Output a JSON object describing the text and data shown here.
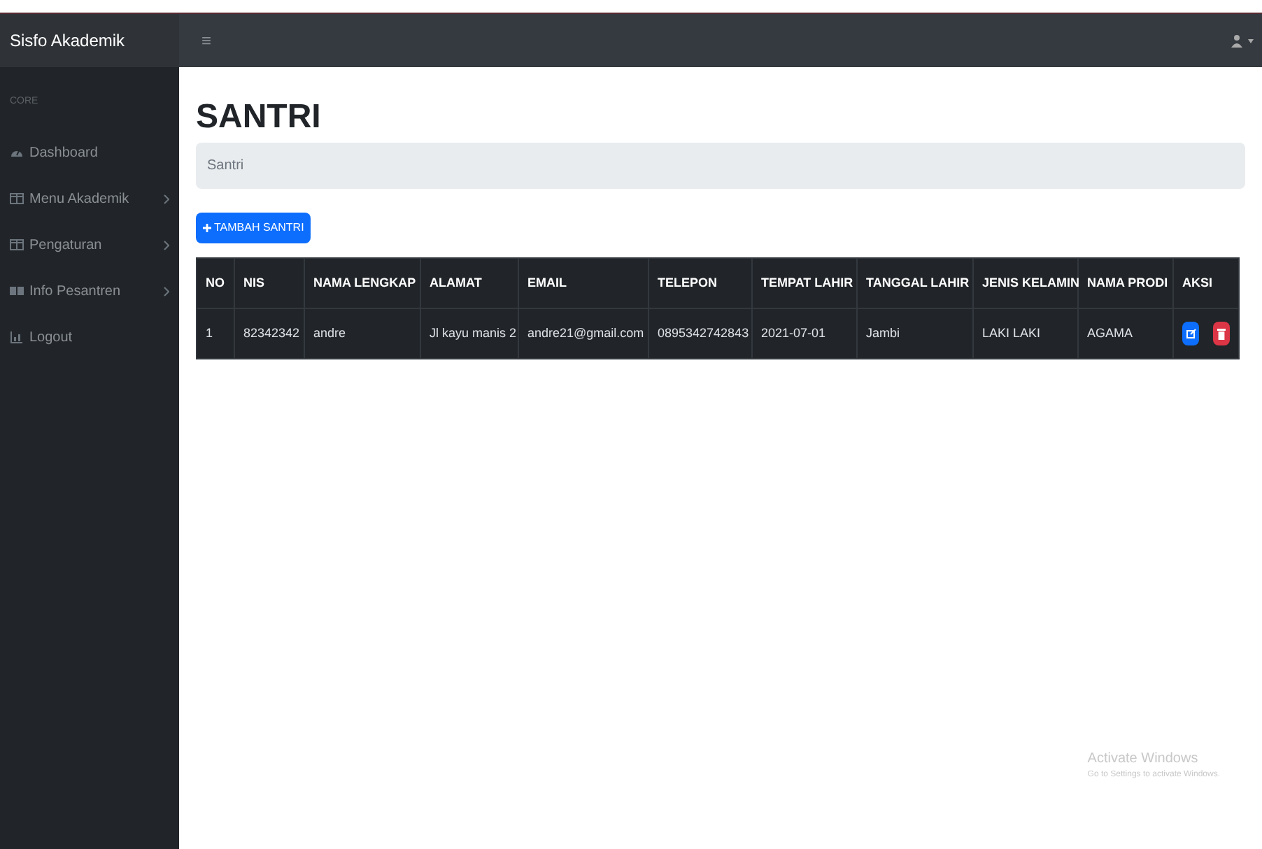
{
  "navbar": {
    "brand": "Sisfo Akademik",
    "menu_toggle": "≡"
  },
  "sidebar": {
    "heading": "CORE",
    "items": [
      {
        "label": "Dashboard",
        "kind": "gauge",
        "expandable": false
      },
      {
        "label": "Menu Akademik",
        "kind": "columns",
        "expandable": true
      },
      {
        "label": "Pengaturan",
        "kind": "columns",
        "expandable": true
      },
      {
        "label": "Info Pesantren",
        "kind": "book",
        "expandable": true
      },
      {
        "label": "Logout",
        "kind": "chart",
        "expandable": false
      }
    ]
  },
  "page": {
    "title": "SANTRI",
    "breadcrumb": "Santri",
    "add_button": "TAMBAH SANTRI"
  },
  "table": {
    "columns": [
      "NO",
      "NIS",
      "NAMA LENGKAP",
      "ALAMAT",
      "EMAIL",
      "TELEPON",
      "TEMPAT LAHIR",
      "TANGGAL LAHIR",
      "JENIS KELAMIN",
      "NAMA PRODI",
      "AKSI"
    ],
    "rows": [
      {
        "cells": [
          "1",
          "82342342",
          "andre",
          "Jl kayu manis 2",
          "andre21@gmail.com",
          "0895342742843",
          "2021-07-01",
          "Jambi",
          "LAKI LAKI",
          "AGAMA"
        ]
      }
    ]
  },
  "os_notice": {
    "title": "Activate Windows",
    "subtitle": "Go to Settings to activate Windows."
  }
}
